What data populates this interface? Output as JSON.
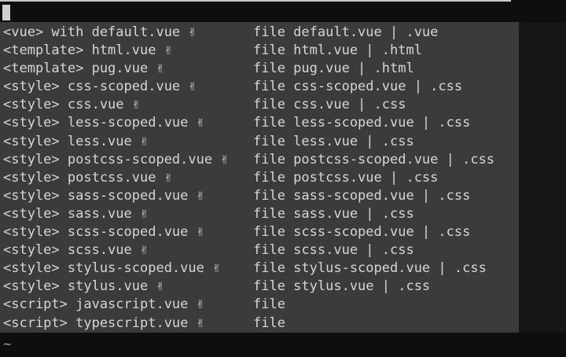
{
  "lines": [
    {
      "left": "<vue> with default.vue ✌",
      "right": "file default.vue | .vue"
    },
    {
      "left": "<template> html.vue ✌",
      "right": "file html.vue | .html"
    },
    {
      "left": "<template> pug.vue ✌",
      "right": "file pug.vue | .html"
    },
    {
      "left": "<style> css-scoped.vue ✌",
      "right": "file css-scoped.vue | .css"
    },
    {
      "left": "<style> css.vue ✌",
      "right": "file css.vue | .css"
    },
    {
      "left": "<style> less-scoped.vue ✌",
      "right": "file less-scoped.vue | .css"
    },
    {
      "left": "<style> less.vue ✌",
      "right": "file less.vue | .css"
    },
    {
      "left": "<style> postcss-scoped.vue ✌",
      "right": "file postcss-scoped.vue | .css"
    },
    {
      "left": "<style> postcss.vue ✌",
      "right": "file postcss.vue | .css"
    },
    {
      "left": "<style> sass-scoped.vue ✌",
      "right": "file sass-scoped.vue | .css"
    },
    {
      "left": "<style> sass.vue ✌",
      "right": "file sass.vue | .css"
    },
    {
      "left": "<style> scss-scoped.vue ✌",
      "right": "file scss-scoped.vue | .css"
    },
    {
      "left": "<style> scss.vue ✌",
      "right": "file scss.vue | .css"
    },
    {
      "left": "<style> stylus-scoped.vue ✌",
      "right": "file stylus-scoped.vue | .css"
    },
    {
      "left": "<style> stylus.vue ✌",
      "right": "file stylus.vue | .css"
    },
    {
      "left": "<script> javascript.vue ✌",
      "right": "file"
    },
    {
      "left": "<script> typescript.vue ✌",
      "right": "file"
    }
  ],
  "tilde": "~"
}
